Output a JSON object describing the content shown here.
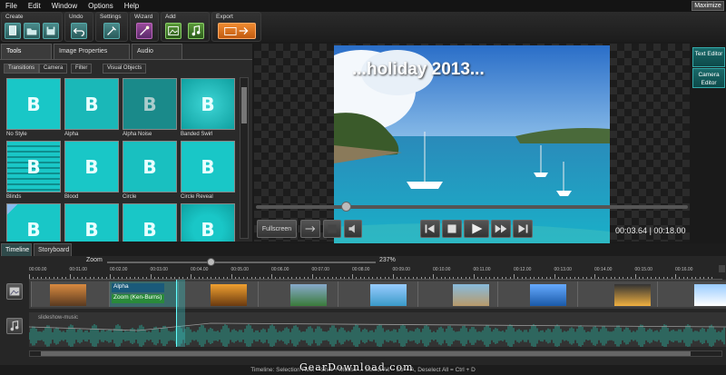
{
  "menu": [
    "File",
    "Edit",
    "Window",
    "Options",
    "Help"
  ],
  "maximize_label": "Maximize",
  "toolbar": {
    "groups": [
      {
        "label": "Create"
      },
      {
        "label": "Undo"
      },
      {
        "label": "Settings"
      },
      {
        "label": "Wizard"
      },
      {
        "label": "Add"
      },
      {
        "label": "Export"
      }
    ]
  },
  "panel": {
    "tabs": [
      "Tools",
      "Image Properties",
      "Audio"
    ],
    "subtabs": [
      "Transitions",
      "Camera",
      "Filter",
      "Visual Objects"
    ],
    "transitions": [
      "No Style",
      "Alpha",
      "Alpha Noise",
      "Banded Swirl",
      "Blinds",
      "Blood",
      "Circle",
      "Circle Reveal"
    ],
    "tile_letter": "B"
  },
  "preview": {
    "caption": "...holiday 2013...",
    "fullscreen_label": "Fullscreen",
    "current_time": "00:03.64",
    "separator": "|",
    "total_time": "00:18.00",
    "playback_position": 0.2
  },
  "editors": [
    "Text Editor",
    "Camera Editor"
  ],
  "timeline": {
    "tabs": [
      "Timeline",
      "Storyboard"
    ],
    "zoom_label": "Zoom",
    "zoom_value": "237%",
    "ruler_ticks": [
      "00:00.00",
      "00:01.00",
      "00:02.00",
      "00:03.00",
      "00:04.00",
      "00:05.00",
      "00:06.00",
      "00:07.00",
      "00:08.00",
      "00:09.00",
      "00:10.00",
      "00:11.00",
      "00:12.00",
      "00:13.00",
      "00:14.00",
      "00:15.00",
      "00:16.00"
    ],
    "clip_labels": [
      "Alpha",
      "Zoom (Ken-Burns)"
    ],
    "audio_track_label": "slideshow-music"
  },
  "status_text": "Timeline: Selection Rect = Shift + Mouse ... Select All = Ctr + A, Deselect All = Ctrl + D",
  "watermark": "GearDownload.com",
  "colors": {
    "accent": "#20b5b5",
    "tile": "#19c7c7",
    "export": "#e06a10"
  }
}
